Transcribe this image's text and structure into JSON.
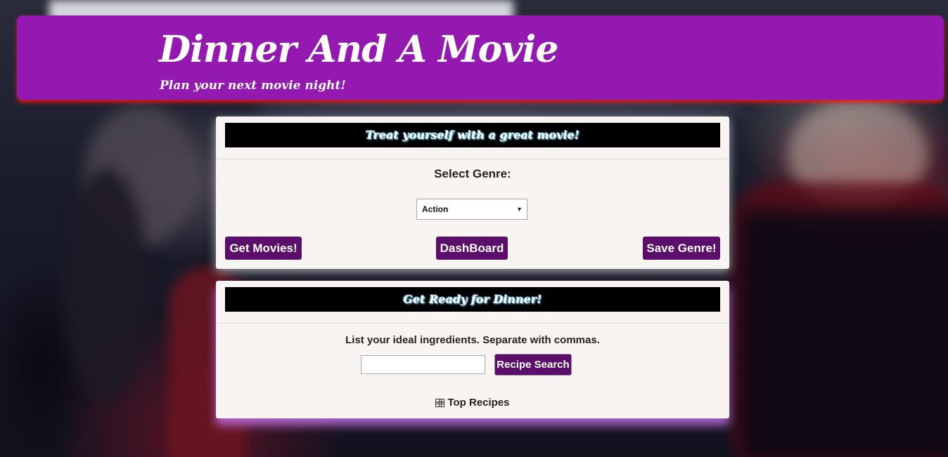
{
  "header": {
    "title": "Dinner And A Movie",
    "subtitle": "Plan your next movie night!"
  },
  "movie_card": {
    "heading": "Treat yourself with a great movie!",
    "select_label": "Select Genre:",
    "genre_select": {
      "selected": "Action"
    },
    "buttons": {
      "get_movies": "Get Movies!",
      "dashboard": "DashBoard",
      "save_genre": "Save Genre!"
    }
  },
  "dinner_card": {
    "heading": "Get Ready for Dinner!",
    "ingredients_label": "List your ideal ingredients. Separate with commas.",
    "ingredients_input": {
      "value": "",
      "placeholder": ""
    },
    "recipe_search_button": "Recipe Search",
    "top_recipes_link": "Top Recipes",
    "top_recipes_icon": "table-icon"
  },
  "colors": {
    "header_bg": "#9319b1",
    "button_bg": "#5c0f6a",
    "heading_bar_bg": "#000000",
    "card_bg": "#f7f4f1"
  }
}
